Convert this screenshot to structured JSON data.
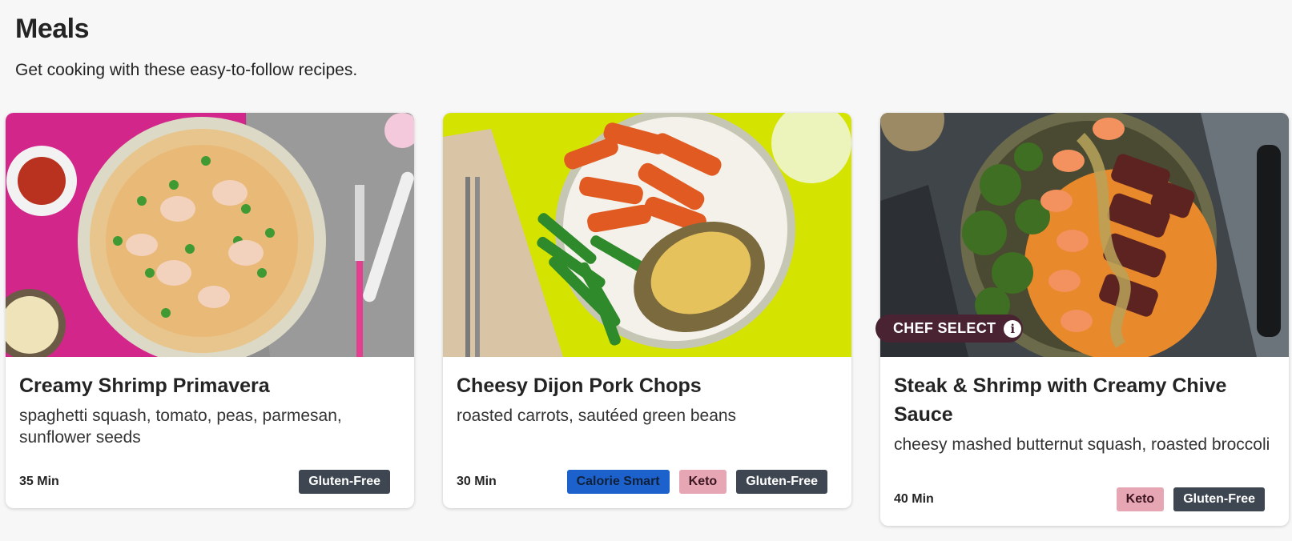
{
  "page": {
    "title": "Meals",
    "subtitle": "Get cooking with these easy-to-follow recipes."
  },
  "colors": {
    "background": "#f7f7f7",
    "gluten_free": "#3d4651",
    "calorie_smart": "#1d62cc",
    "keto": "#e7a6b4",
    "chef_select": "#4a2333"
  },
  "meals": [
    {
      "name": "Creamy Shrimp Primavera",
      "description": "spaghetti squash, tomato, peas, parmesan, sunflower seeds",
      "time": "35 Min",
      "tags": [
        "Gluten-Free"
      ]
    },
    {
      "name": "Cheesy Dijon Pork Chops",
      "description": "roasted carrots, sautéed green beans",
      "time": "30 Min",
      "tags": [
        "Calorie Smart",
        "Keto",
        "Gluten-Free"
      ]
    },
    {
      "name": "Steak & Shrimp with Creamy Chive Sauce",
      "description": "cheesy mashed butternut squash, roasted broccoli",
      "time": "40 Min",
      "tags": [
        "Keto",
        "Gluten-Free"
      ],
      "badge": "CHEF SELECT"
    }
  ]
}
